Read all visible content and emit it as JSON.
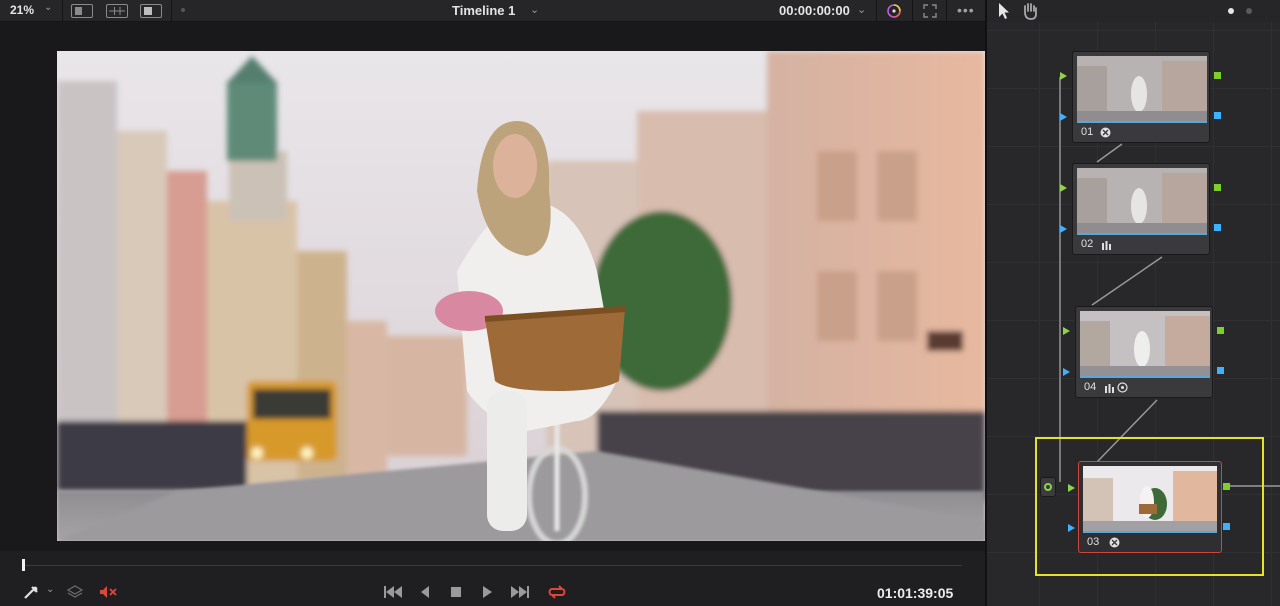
{
  "toolbar": {
    "zoom": "21%",
    "timeline_name": "Timeline 1",
    "timecode": "00:00:00:00"
  },
  "transport": {
    "timecode": "01:01:39:05",
    "buttons": [
      "jump-to-start",
      "step-back",
      "stop",
      "play",
      "jump-to-end",
      "loop"
    ]
  },
  "node_editor": {
    "nodes": [
      {
        "label": "01",
        "icon": "grain-icon"
      },
      {
        "label": "02",
        "icon": "levels-icon"
      },
      {
        "label": "04",
        "icon": "levels-icon"
      },
      {
        "label": "03",
        "icon": "grain-icon",
        "selected": true
      }
    ],
    "colors": {
      "input_port": "#8fd34a",
      "output_port_green": "#7fcf2a",
      "output_port_blue": "#3fb2ff",
      "selection": "#e5e22a",
      "selected_node_border": "#d0453c"
    }
  }
}
